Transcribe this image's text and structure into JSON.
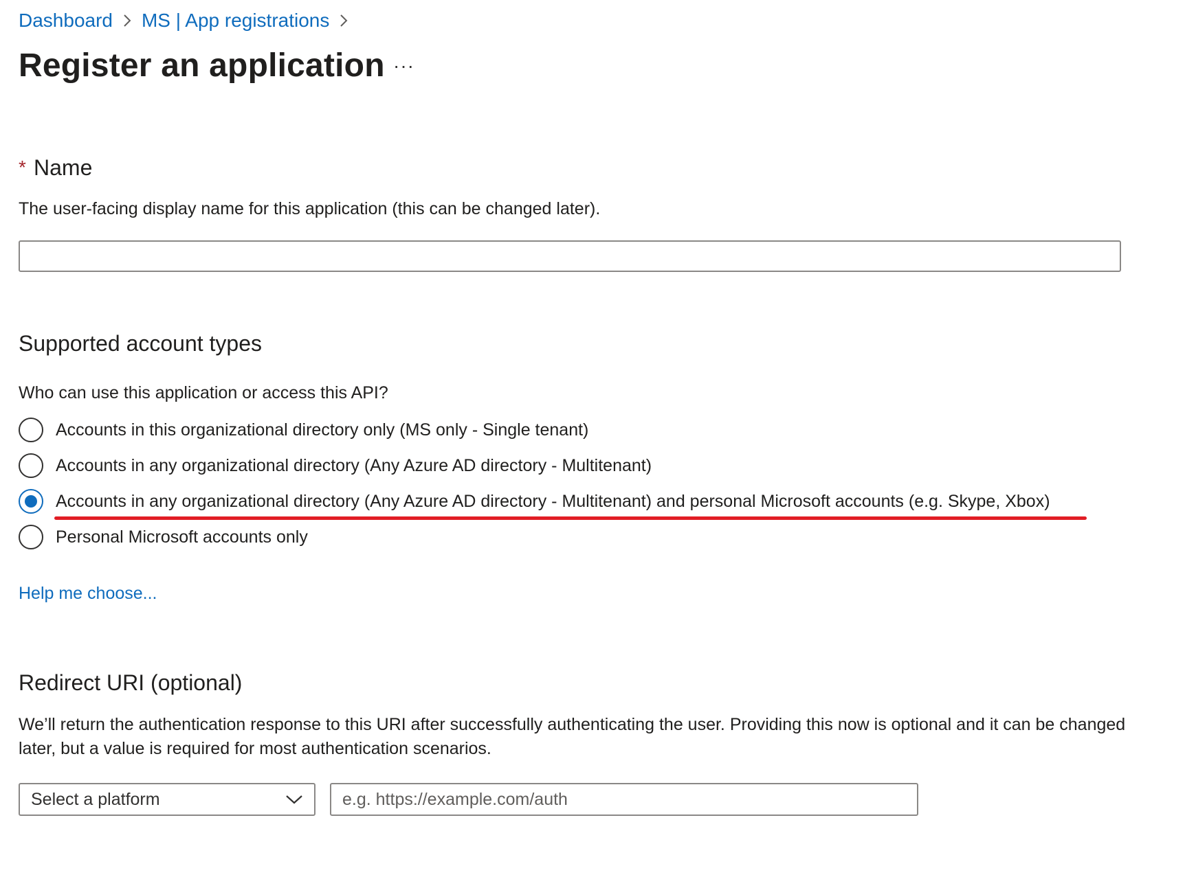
{
  "breadcrumb": {
    "items": [
      {
        "label": "Dashboard"
      },
      {
        "label": "MS | App registrations"
      }
    ]
  },
  "header": {
    "title": "Register an application",
    "more_label": "···"
  },
  "name_section": {
    "required_marker": "*",
    "label": "Name",
    "description": "The user-facing display name for this application (this can be changed later).",
    "value": ""
  },
  "account_types": {
    "heading": "Supported account types",
    "question": "Who can use this application or access this API?",
    "options": [
      {
        "label": "Accounts in this organizational directory only (MS only - Single tenant)",
        "selected": false
      },
      {
        "label": "Accounts in any organizational directory (Any Azure AD directory - Multitenant)",
        "selected": false
      },
      {
        "label": "Accounts in any organizational directory (Any Azure AD directory - Multitenant) and personal Microsoft accounts (e.g. Skype, Xbox)",
        "selected": true
      },
      {
        "label": "Personal Microsoft accounts only",
        "selected": false
      }
    ],
    "help_link": "Help me choose..."
  },
  "redirect": {
    "heading": "Redirect URI (optional)",
    "description": "We’ll return the authentication response to this URI after successfully authenticating the user. Providing this now is optional and it can be changed later, but a value is required for most authentication scenarios.",
    "platform_select": "Select a platform",
    "uri_placeholder": "e.g. https://example.com/auth"
  },
  "colors": {
    "link": "#0f6cbd",
    "radio_selected": "#0f6cbd",
    "annotation_underline": "#e11d25",
    "required_star": "#a4262c"
  },
  "icons": {
    "breadcrumb_separator": "chevron-right-icon",
    "platform_dropdown": "chevron-down-icon"
  }
}
